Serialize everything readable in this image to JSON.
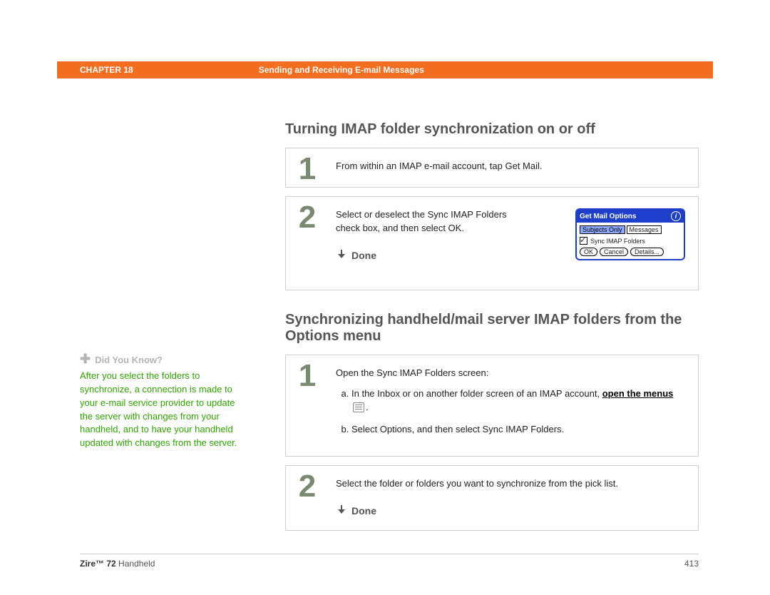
{
  "header": {
    "chapter": "CHAPTER 18",
    "title": "Sending and Receiving E-mail Messages"
  },
  "sidebar": {
    "did_you_know_label": "Did You Know?",
    "did_you_know_body": "After you select the folders to synchronize, a connection is made to your e-mail service provider to update the server with changes from your handheld, and to have your handheld updated with changes from the server."
  },
  "section_a": {
    "title": "Turning IMAP folder synchronization on or off",
    "step1_num": "1",
    "step1_body": "From within an IMAP e-mail account, tap Get Mail.",
    "step2_num": "2",
    "step2_body": "Select or deselect the Sync IMAP Folders check box, and then select OK.",
    "done": "Done"
  },
  "gmo": {
    "title": "Get Mail Options",
    "tab_a": "Subjects Only",
    "tab_b": "Messages",
    "check": "Sync IMAP Folders",
    "ok": "OK",
    "cancel": "Cancel",
    "details": "Details..."
  },
  "section_b": {
    "title": "Synchronizing handheld/mail server IMAP folders from the Options menu",
    "step1_num": "1",
    "step1_intro": "Open the Sync IMAP Folders screen:",
    "step1_a_pre": "In the Inbox or on another folder screen of an IMAP account, ",
    "step1_a_link": "open the menus",
    "step1_b": "Select Options, and then select Sync IMAP Folders.",
    "step2_num": "2",
    "step2_body": "Select the folder or folders you want to synchronize from the pick list.",
    "done": "Done"
  },
  "footer": {
    "product_bold": "Zire™ 72",
    "product_rest": " Handheld",
    "page": "413"
  }
}
